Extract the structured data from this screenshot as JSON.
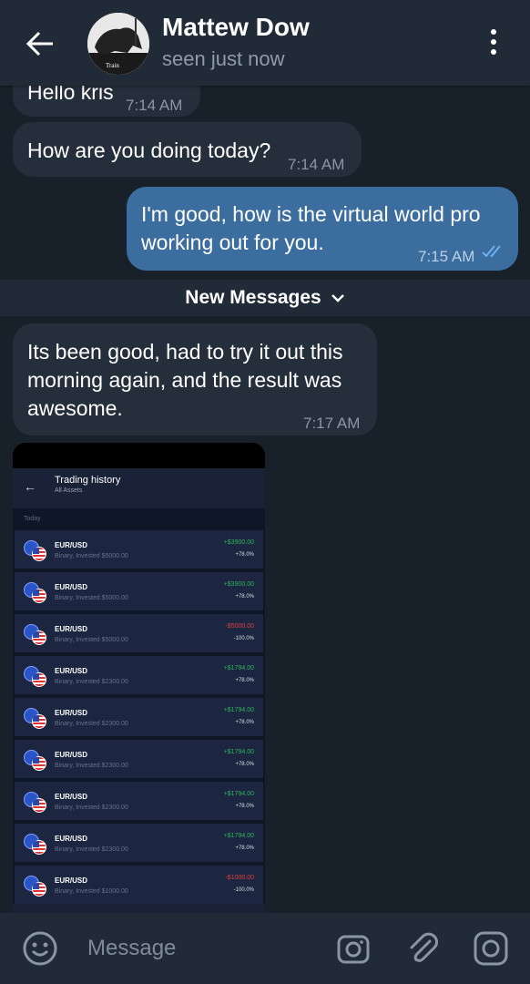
{
  "header": {
    "name": "Mattew Dow",
    "status": "seen just now",
    "avatar_caption": "Train"
  },
  "messages": [
    {
      "direction": "in",
      "text": "Hello kris",
      "time": "7:14 AM"
    },
    {
      "direction": "in",
      "text": "How are you doing today?",
      "time": "7:14 AM"
    },
    {
      "direction": "out",
      "text": "I'm good, how is the virtual world pro\nworking out for you.",
      "time": "7:15 AM"
    },
    {
      "direction": "in",
      "text": "Its been good, had to try it out this\nmorning again, and the result was\nawesome.",
      "time": "7:17 AM"
    }
  ],
  "new_messages_label": "New Messages",
  "screenshot": {
    "title": "Trading history",
    "subtitle": "All Assets",
    "section": "Today",
    "rows": [
      {
        "pair": "EUR/USD",
        "detail": "Binary, Invested $5000.00",
        "amount": "+$3900.00",
        "pct": "+78.0%",
        "positive": true
      },
      {
        "pair": "EUR/USD",
        "detail": "Binary, Invested $5000.00",
        "amount": "+$3900.00",
        "pct": "+78.0%",
        "positive": true
      },
      {
        "pair": "EUR/USD",
        "detail": "Binary, Invested $5000.00",
        "amount": "-$5000.00",
        "pct": "-100.0%",
        "positive": false
      },
      {
        "pair": "EUR/USD",
        "detail": "Binary, Invested $2300.00",
        "amount": "+$1794.00",
        "pct": "+78.0%",
        "positive": true
      },
      {
        "pair": "EUR/USD",
        "detail": "Binary, Invested $2300.00",
        "amount": "+$1794.00",
        "pct": "+78.0%",
        "positive": true
      },
      {
        "pair": "EUR/USD",
        "detail": "Binary, Invested $2300.00",
        "amount": "+$1794.00",
        "pct": "+78.0%",
        "positive": true
      },
      {
        "pair": "EUR/USD",
        "detail": "Binary, Invested $2300.00",
        "amount": "+$1794.00",
        "pct": "+78.0%",
        "positive": true
      },
      {
        "pair": "EUR/USD",
        "detail": "Binary, Invested $2300.00",
        "amount": "+$1794.00",
        "pct": "+78.0%",
        "positive": true
      },
      {
        "pair": "EUR/USD",
        "detail": "Binary, Invested $1000.00",
        "amount": "-$1000.00",
        "pct": "-100.0%",
        "positive": false
      }
    ]
  },
  "input": {
    "placeholder": "Message"
  },
  "icons": {
    "back": "arrow-left-icon",
    "menu": "more-vertical-icon",
    "emoji": "emoji-icon",
    "camera": "camera-icon",
    "attach": "paperclip-icon",
    "instagram": "instagram-icon",
    "read": "double-check-icon",
    "chevron": "chevron-down-icon"
  },
  "colors": {
    "background": "#18202a",
    "header": "#202b37",
    "incoming_bubble": "#252f3b",
    "outgoing_bubble": "#3c6d9f",
    "read_check": "#6fb6f5"
  }
}
